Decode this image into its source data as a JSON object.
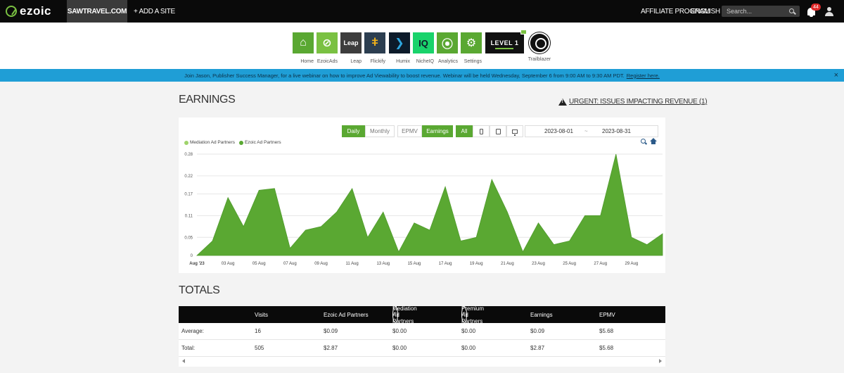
{
  "topbar": {
    "logo_text": "ezoic",
    "site": "SAWTRAVEL.COM",
    "add_site": "+ ADD A SITE",
    "affiliate": "AFFILIATE PROGRAM",
    "language": "ENGLISH",
    "search_placeholder": "Search...",
    "notifications": "44"
  },
  "apps": [
    {
      "label": "Home",
      "icon": "home-icon",
      "color": "#5aa832"
    },
    {
      "label": "EzoicAds",
      "icon": "ezoicads-icon",
      "color": "#7ac142"
    },
    {
      "label": "Leap",
      "icon": "leap-icon",
      "color": "#3d3d3d",
      "tile_text": "Leap"
    },
    {
      "label": "Flickify",
      "icon": "flickify-icon",
      "color": "#2c3e50"
    },
    {
      "label": "Humix",
      "icon": "humix-icon",
      "color": "#0d1b2a"
    },
    {
      "label": "NicheIQ",
      "icon": "nicheiq-icon",
      "color": "#19d36b",
      "tile_text": "IQ"
    },
    {
      "label": "Analytics",
      "icon": "analytics-icon",
      "color": "#5aa832"
    },
    {
      "label": "Settings",
      "icon": "gear-icon",
      "color": "#5aa832"
    }
  ],
  "level_badge": "LEVEL 1",
  "trailblazer_label": "Trailblazer",
  "banner": {
    "text": "Join Jason, Publisher Success Manager, for a live webinar on how to improve Ad Viewability to boost revenue. Webinar will be held Wednesday, September 6 from 9:00 AM to 9:30 AM PDT.",
    "link": "Register here.",
    "close": "×"
  },
  "earnings": {
    "title": "EARNINGS",
    "urgent": "URGENT: ISSUES IMPACTING REVENUE (1)",
    "period_buttons": [
      "Daily",
      "Monthly"
    ],
    "metric_buttons": [
      "EPMV",
      "Earnings"
    ],
    "device_all": "All",
    "date_from": "2023-08-01",
    "date_sep": "~",
    "date_to": "2023-08-31",
    "legend": [
      {
        "name": "Mediation Ad Partners",
        "color": "#9fd36b"
      },
      {
        "name": "Ezoic Ad Partners",
        "color": "#5aa832"
      }
    ]
  },
  "chart_data": {
    "type": "area",
    "y_ticks": [
      "0.28",
      "0.22",
      "0.17",
      "0.11",
      "0.05",
      "0"
    ],
    "y_tick_values": [
      0.28,
      0.22,
      0.17,
      0.11,
      0.05,
      0
    ],
    "ylim": [
      0,
      0.28
    ],
    "x_tick_labels": [
      "Aug '23",
      "03 Aug",
      "05 Aug",
      "07 Aug",
      "09 Aug",
      "11 Aug",
      "13 Aug",
      "15 Aug",
      "17 Aug",
      "19 Aug",
      "21 Aug",
      "23 Aug",
      "25 Aug",
      "27 Aug",
      "29 Aug"
    ],
    "x": [
      "2023-08-01",
      "2023-08-02",
      "2023-08-03",
      "2023-08-04",
      "2023-08-05",
      "2023-08-06",
      "2023-08-07",
      "2023-08-08",
      "2023-08-09",
      "2023-08-10",
      "2023-08-11",
      "2023-08-12",
      "2023-08-13",
      "2023-08-14",
      "2023-08-15",
      "2023-08-16",
      "2023-08-17",
      "2023-08-18",
      "2023-08-19",
      "2023-08-20",
      "2023-08-21",
      "2023-08-22",
      "2023-08-23",
      "2023-08-24",
      "2023-08-25",
      "2023-08-26",
      "2023-08-27",
      "2023-08-28",
      "2023-08-29",
      "2023-08-30",
      "2023-08-31"
    ],
    "series": [
      {
        "name": "Ezoic Ad Partners",
        "color": "#5aa832",
        "values": [
          0.0,
          0.04,
          0.16,
          0.08,
          0.18,
          0.185,
          0.02,
          0.07,
          0.08,
          0.12,
          0.185,
          0.05,
          0.12,
          0.01,
          0.09,
          0.07,
          0.19,
          0.04,
          0.05,
          0.21,
          0.12,
          0.01,
          0.09,
          0.03,
          0.04,
          0.11,
          0.11,
          0.28,
          0.05,
          0.03,
          0.06
        ]
      },
      {
        "name": "Mediation Ad Partners",
        "color": "#9fd36b",
        "values": [
          0,
          0,
          0,
          0,
          0,
          0,
          0,
          0,
          0,
          0,
          0,
          0,
          0,
          0,
          0,
          0,
          0,
          0,
          0,
          0,
          0,
          0,
          0,
          0,
          0,
          0,
          0,
          0,
          0,
          0,
          0
        ]
      }
    ]
  },
  "totals": {
    "title": "TOTALS",
    "columns": [
      "Visits",
      "Ezoic Ad Partners",
      "Mediation Ad Partners",
      "Premium Ad Partners",
      "Earnings",
      "EPMV"
    ],
    "rows": [
      {
        "label": "Average:",
        "values": [
          "16",
          "$0.09",
          "$0.00",
          "$0.00",
          "$0.09",
          "$5.68"
        ]
      },
      {
        "label": "Total:",
        "values": [
          "505",
          "$2.87",
          "$0.00",
          "$0.00",
          "$2.87",
          "$5.68"
        ]
      }
    ]
  }
}
